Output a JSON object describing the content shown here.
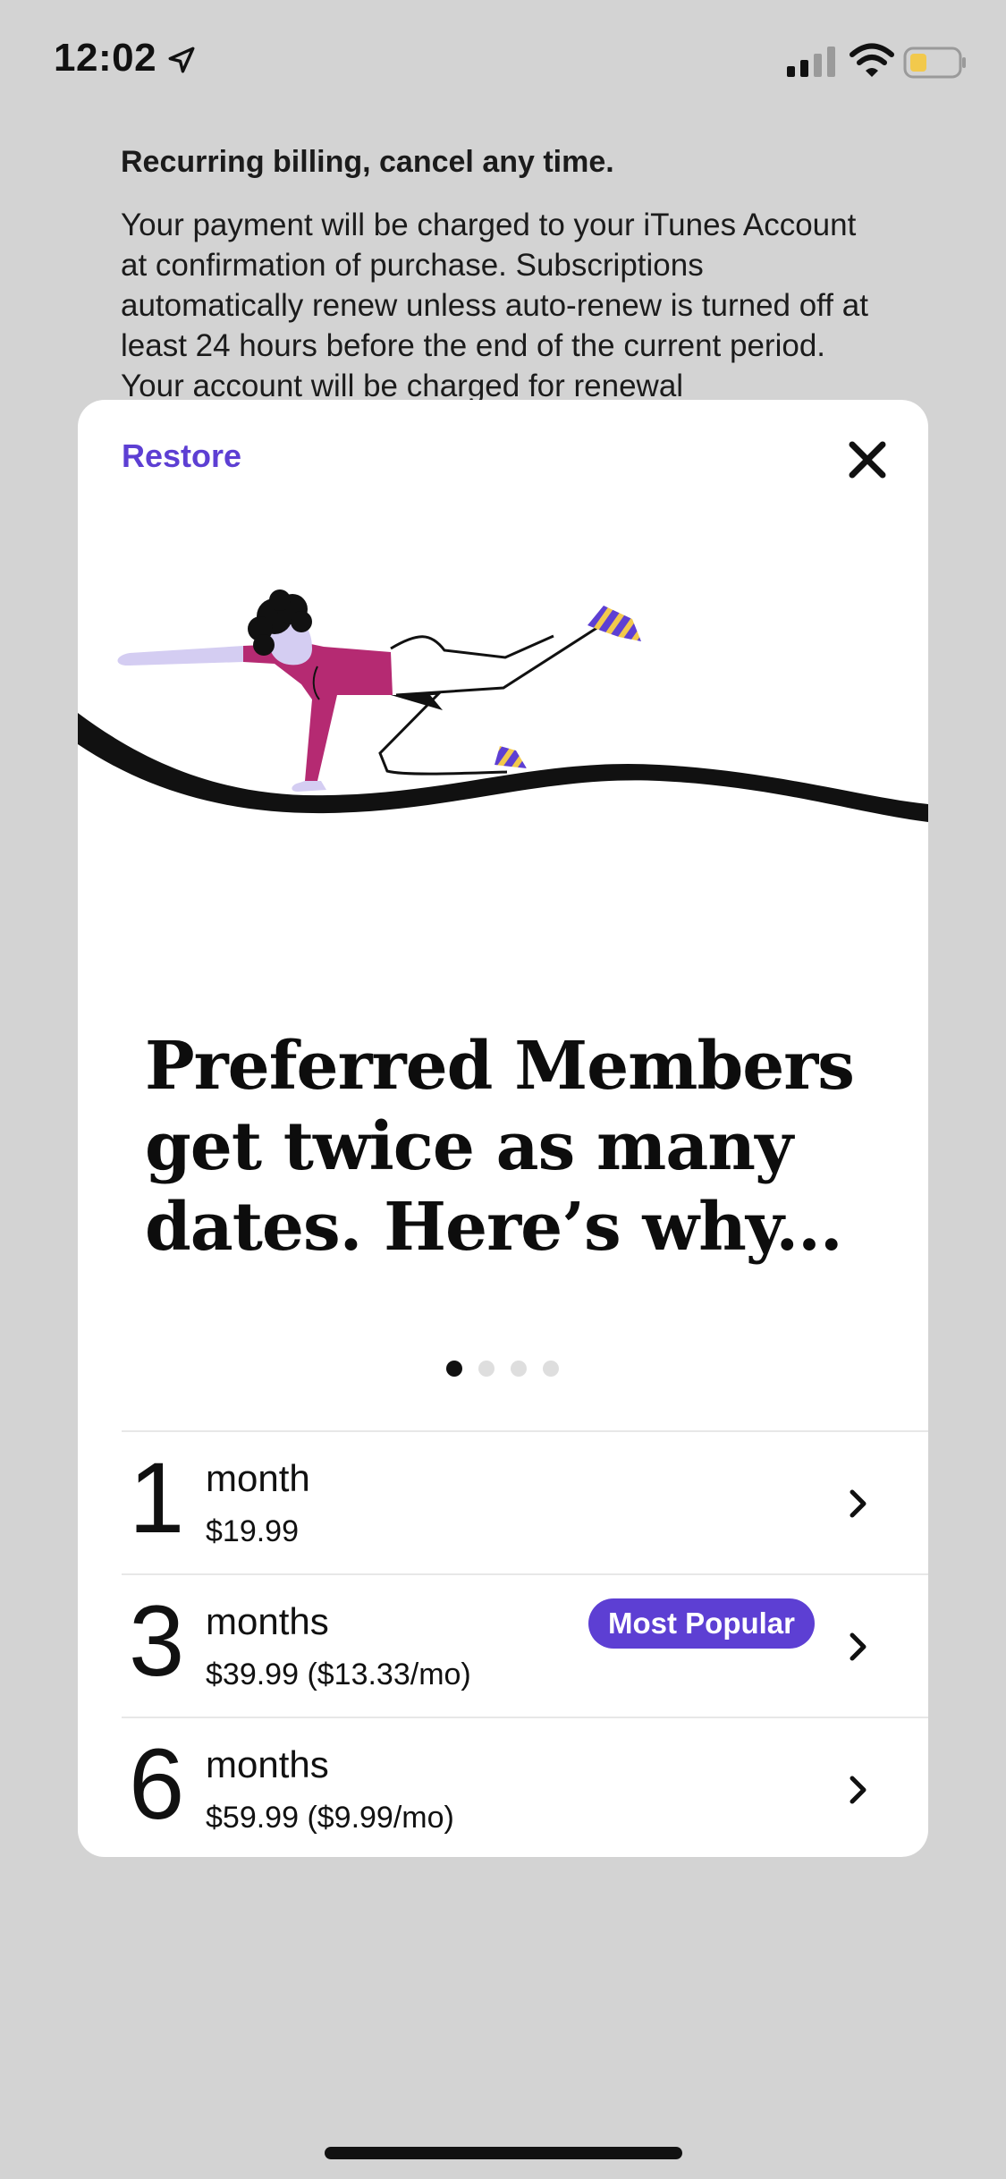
{
  "status": {
    "time": "12:02",
    "location_icon": "location-arrow-icon",
    "signal_icon": "cellular-signal-icon",
    "wifi_icon": "wifi-icon",
    "battery_icon": "battery-low-icon"
  },
  "background": {
    "title": "Recurring billing, cancel any time.",
    "body": "Your payment will be charged to your iTunes Account at confirmation of purchase. Subscriptions automatically renew unless auto-renew is turned off at least 24 hours before the end of the current period. Your account will be charged for renewal"
  },
  "modal": {
    "restore_label": "Restore",
    "close_icon": "close-icon",
    "headline": "Preferred Members get twice as many dates. Here’s why...",
    "page_dots": {
      "count": 4,
      "active_index": 0
    },
    "plans": [
      {
        "number": "1",
        "unit": "month",
        "price": "$19.99",
        "badge": ""
      },
      {
        "number": "3",
        "unit": "months",
        "price": "$39.99 ($13.33/mo)",
        "badge": "Most Popular"
      },
      {
        "number": "6",
        "unit": "months",
        "price": "$59.99 ($9.99/mo)",
        "badge": ""
      }
    ]
  },
  "colors": {
    "accent": "#5d3fd3",
    "shirt": "#b52a72",
    "skin": "#d4cdf2"
  }
}
